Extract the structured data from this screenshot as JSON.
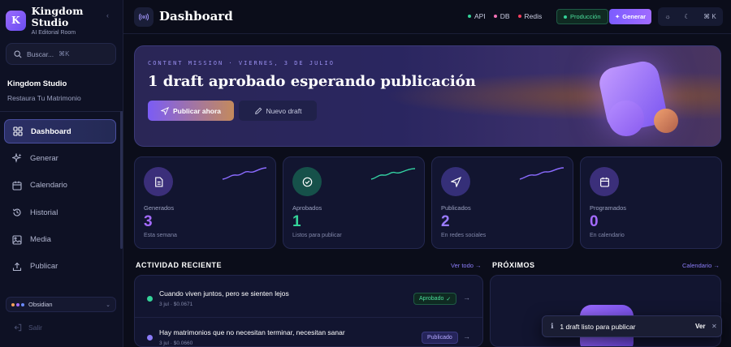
{
  "brand": {
    "initial": "K",
    "name": "Kingdom Studio",
    "subtitle": "AI Editorial Room"
  },
  "search": {
    "placeholder": "Buscar...",
    "shortcut": "⌘K"
  },
  "workspace": {
    "name": "Kingdom Studio",
    "subtitle": "Restaura Tu Matrimonio"
  },
  "nav": [
    {
      "label": "Dashboard",
      "icon": "grid-icon",
      "active": true
    },
    {
      "label": "Generar",
      "icon": "sparkles-icon",
      "active": false
    },
    {
      "label": "Calendario",
      "icon": "calendar-icon",
      "active": false
    },
    {
      "label": "Historial",
      "icon": "history-icon",
      "active": false
    },
    {
      "label": "Media",
      "icon": "image-icon",
      "active": false
    },
    {
      "label": "Publicar",
      "icon": "upload-icon",
      "active": false
    }
  ],
  "theme": {
    "label": "Obsidian",
    "colors": [
      "#f5a25a",
      "#a46bff",
      "#6a8bff"
    ]
  },
  "logout_label": "Salir",
  "header": {
    "title": "Dashboard",
    "status": [
      {
        "label": "API",
        "color": "#34d399"
      },
      {
        "label": "DB",
        "color": "#f472b6"
      },
      {
        "label": "Redis",
        "color": "#f43f5e"
      }
    ],
    "env_label": "Producción",
    "generate_label": "Generar",
    "tools_shortcut": "⌘ K"
  },
  "hero": {
    "eyebrow": "CONTENT MISSION · VIERNES, 3 DE JULIO",
    "title": "1 draft aprobado esperando publicación",
    "primary_label": "Publicar ahora",
    "secondary_label": "Nuevo draft"
  },
  "stats": [
    {
      "label": "Generados",
      "value": "3",
      "sub": "Esta semana",
      "icon": "document-icon",
      "color": "#a46bff",
      "spark": "#8b6bff"
    },
    {
      "label": "Aprobados",
      "value": "1",
      "sub": "Listos para publicar",
      "icon": "check-circle-icon",
      "color": "#34d399",
      "spark": "#34d3a3"
    },
    {
      "label": "Publicados",
      "value": "2",
      "sub": "En redes sociales",
      "icon": "send-icon",
      "color": "#9a7bff",
      "spark": "#8b6bff"
    },
    {
      "label": "Programados",
      "value": "0",
      "sub": "En calendario",
      "icon": "calendar-icon",
      "color": "#a46bff",
      "spark": ""
    }
  ],
  "activity": {
    "title": "ACTIVIDAD RECIENTE",
    "link": "Ver todo",
    "items": [
      {
        "title": "Cuando viven juntos, pero se sienten lejos",
        "meta": "3 jul · $0.0671",
        "status": "Aprobado",
        "dot": "#34d399"
      },
      {
        "title": "Hay matrimonios que no necesitan terminar, necesitan sanar",
        "meta": "3 jul · $0.0660",
        "status": "Publicado",
        "dot": "#8b7cf8"
      }
    ]
  },
  "upcoming": {
    "title": "PRÓXIMOS",
    "link": "Calendario"
  },
  "toast": {
    "message": "1 draft listo para publicar",
    "action": "Ver"
  }
}
